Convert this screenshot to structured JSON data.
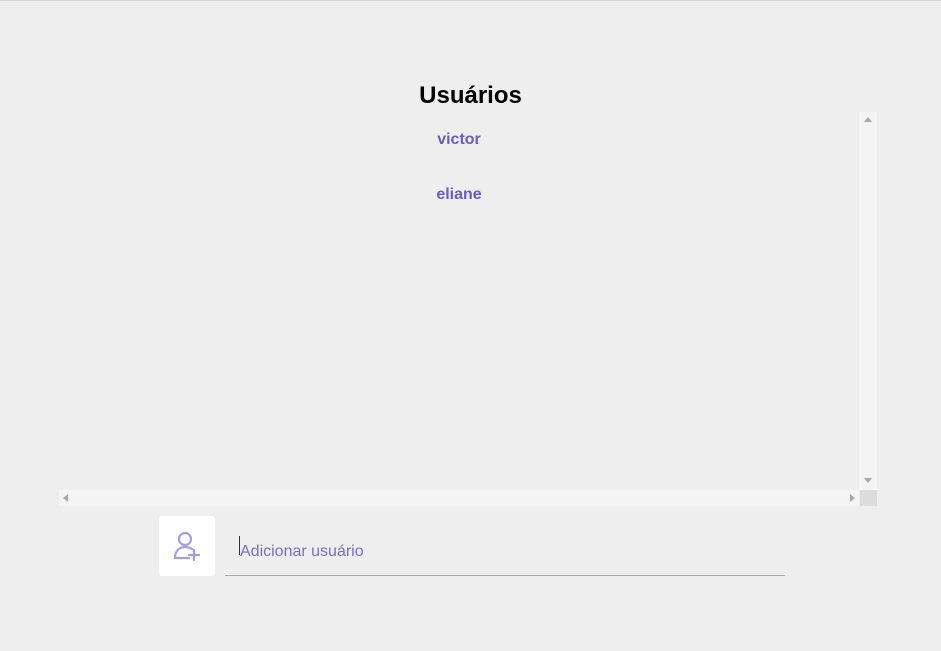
{
  "header": {
    "title": "Usuários"
  },
  "users": [
    {
      "name": "victor"
    },
    {
      "name": "eliane"
    }
  ],
  "add_user": {
    "icon": "user-plus-icon",
    "placeholder": "Adicionar usuário",
    "value": ""
  },
  "colors": {
    "accent": "#6e5bbf",
    "background": "#eeeeee",
    "input_border": "#a99de0"
  }
}
